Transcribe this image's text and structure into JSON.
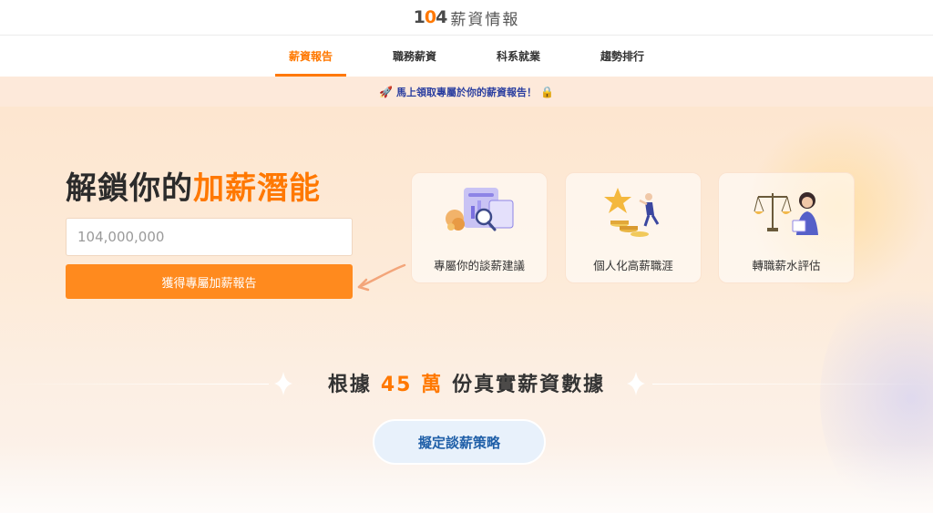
{
  "header": {
    "logo_prefix": "1",
    "logo_zero": "0",
    "logo_suffix": "4",
    "brand_name": "薪資情報"
  },
  "nav": {
    "items": [
      {
        "label": "薪資報告",
        "active": true
      },
      {
        "label": "職務薪資",
        "active": false
      },
      {
        "label": "科系就業",
        "active": false
      },
      {
        "label": "趨勢排行",
        "active": false
      }
    ]
  },
  "promo": {
    "rocket_icon": "🚀",
    "text": "馬上領取專屬於你的薪資報告！",
    "lock_icon": "🔒"
  },
  "hero": {
    "title_main": "解鎖你的",
    "title_accent": "加薪潛能",
    "salary_input": {
      "value": "",
      "placeholder": "104,000,000"
    },
    "cta_label": "獲得專屬加薪報告"
  },
  "features": [
    {
      "label": "專屬你的談薪建議",
      "icon": "report-analysis-icon"
    },
    {
      "label": "個人化高薪職涯",
      "icon": "career-star-stairs-icon"
    },
    {
      "label": "轉職薪水評估",
      "icon": "scales-evaluation-icon"
    }
  ],
  "stats": {
    "prefix": "根據",
    "number": "45",
    "unit": "萬",
    "suffix": "份真實薪資數據"
  },
  "strategy_button": {
    "label": "擬定談薪策略"
  },
  "colors": {
    "accent": "#ff7800",
    "cta": "#ff8a1e",
    "promo_text": "#2a3ea0",
    "strategy_text": "#1f5fa8"
  }
}
